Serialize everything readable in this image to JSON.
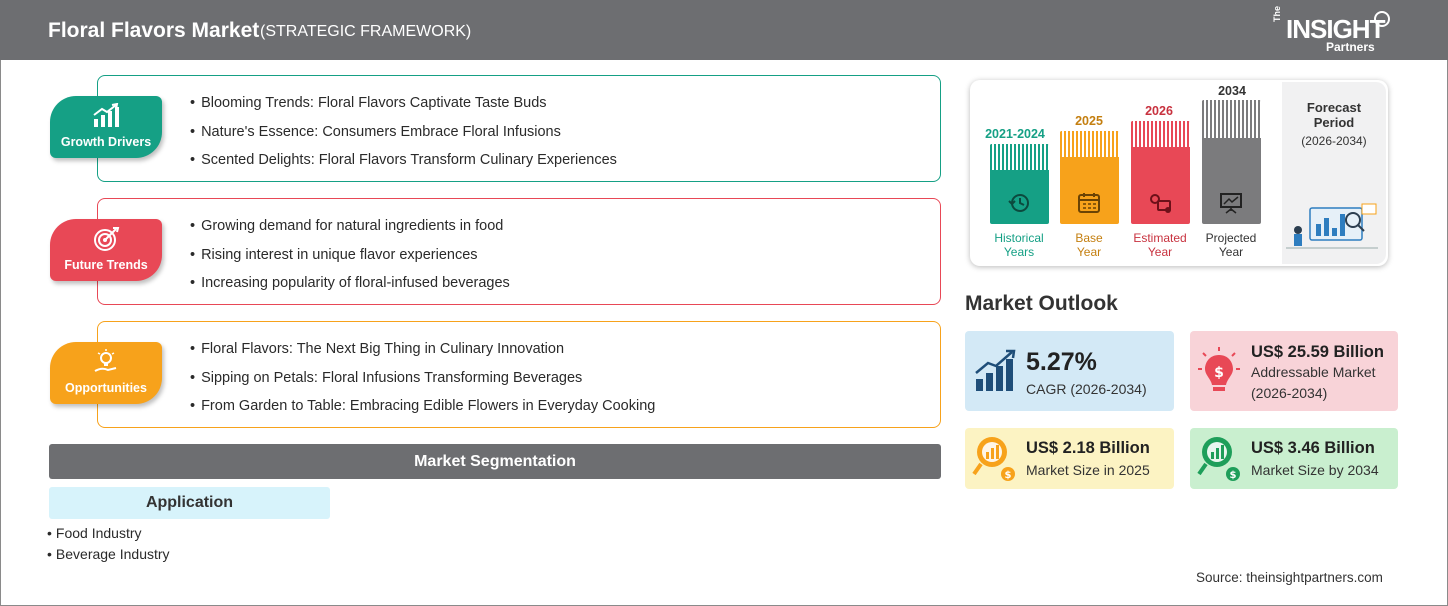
{
  "header": {
    "title": "Floral Flavors Market",
    "subtitle": "(STRATEGIC FRAMEWORK)",
    "logo": {
      "the": "The",
      "insight": "INSIGHT",
      "partners": "Partners"
    }
  },
  "framework": {
    "growth_drivers": {
      "label": "Growth Drivers",
      "color": "#15a085",
      "items": [
        "Blooming Trends: Floral Flavors Captivate Taste Buds",
        "Nature's Essence: Consumers Embrace Floral Infusions",
        "Scented Delights: Floral Flavors Transform Culinary Experiences"
      ]
    },
    "future_trends": {
      "label": "Future Trends",
      "color": "#e84856",
      "items": [
        "Growing demand for natural ingredients in food",
        "Rising interest in unique flavor experiences",
        "Increasing popularity of floral-infused beverages"
      ]
    },
    "opportunities": {
      "label": "Opportunities",
      "color": "#f7a21b",
      "items": [
        "Floral Flavors: The Next Big Thing in Culinary Innovation",
        "Sipping on Petals: Floral Infusions Transforming Beverages",
        "From Garden to Table: Embracing Edible Flowers in Everyday Cooking"
      ]
    }
  },
  "segmentation": {
    "title": "Market Segmentation",
    "tab": "Application",
    "items": [
      "Food Industry",
      "Beverage Industry"
    ]
  },
  "timeline": {
    "historical": {
      "year": "2021-2024",
      "line1": "Historical",
      "line2": "Years",
      "color": "#15a085"
    },
    "base": {
      "year": "2025",
      "line1": "Base",
      "line2": "Year",
      "color": "#f7a21b"
    },
    "estimated": {
      "year": "2026",
      "line1": "Estimated",
      "line2": "Year",
      "color": "#e84856"
    },
    "projected": {
      "year": "2034",
      "line1": "Projected",
      "line2": "Year",
      "color": "#7b7b7d"
    },
    "forecast": {
      "line1": "Forecast",
      "line2": "Period",
      "range": "(2026-2034)"
    }
  },
  "outlook": {
    "title": "Market Outlook",
    "cagr": {
      "value": "5.27%",
      "label": "CAGR (2026-2034)",
      "bg": "#d3e9f6"
    },
    "addressable": {
      "value": "US$ 25.59 Billion",
      "line1": "Addressable Market",
      "line2": "(2026-2034)",
      "bg": "#f8d3d8"
    },
    "size_2025": {
      "value": "US$ 2.18 Billion",
      "label": "Market Size in 2025",
      "bg": "#fcf3c3"
    },
    "size_2034": {
      "value": "US$ 3.46 Billion",
      "label": "Market Size by 2034",
      "bg": "#c9efcf"
    }
  },
  "source": "Source: theinsightpartners.com"
}
